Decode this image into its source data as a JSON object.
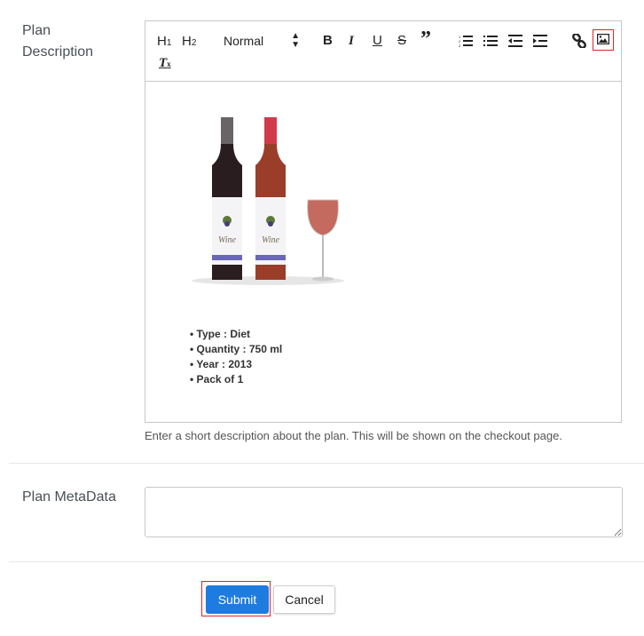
{
  "form": {
    "description": {
      "label_line1": "Plan",
      "label_line2": "Description",
      "help_text": "Enter a short description about the plan. This will be shown on the checkout page."
    },
    "metadata": {
      "label": "Plan MetaData",
      "value": ""
    }
  },
  "toolbar": {
    "h1": "H1",
    "h2": "H2",
    "format_select": "Normal",
    "bold": "B",
    "italic": "I",
    "underline": "U",
    "strike": "S",
    "quote": "”",
    "icons": [
      "header-1-icon",
      "header-2-icon",
      "format-select",
      "bold-icon",
      "italic-icon",
      "underline-icon",
      "strikethrough-icon",
      "blockquote-icon",
      "ordered-list-icon",
      "bullet-list-icon",
      "outdent-icon",
      "indent-icon",
      "link-icon",
      "image-icon",
      "clear-format-icon"
    ],
    "highlight_color": "#e0232a"
  },
  "content": {
    "image_alt": "Two wine bottles with a glass of rosé wine",
    "bottle_label_text": "Wine",
    "specs": [
      "Type : Diet",
      "Quantity : 750 ml",
      "Year : 2013",
      "Pack of 1"
    ]
  },
  "actions": {
    "submit": "Submit",
    "cancel": "Cancel",
    "primary_color": "#1e7be0"
  }
}
